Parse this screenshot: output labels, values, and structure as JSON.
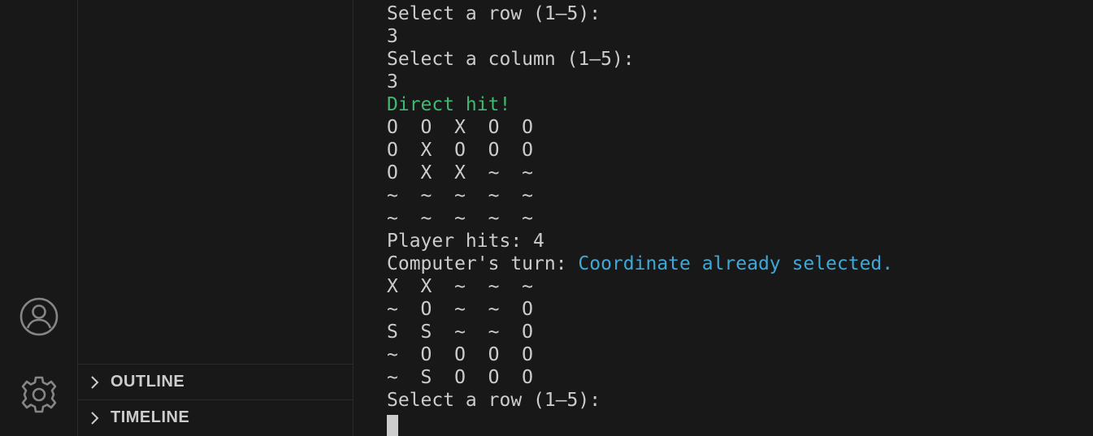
{
  "activity_bar": {
    "account_icon": "account-icon",
    "settings_icon": "gear-icon"
  },
  "sidebar": {
    "sections": [
      {
        "label": "OUTLINE"
      },
      {
        "label": "TIMELINE"
      }
    ]
  },
  "terminal": {
    "lines": [
      {
        "text": "Select a row (1–5):",
        "style": "normal"
      },
      {
        "text": "3",
        "style": "normal"
      },
      {
        "text": "Select a column (1–5):",
        "style": "normal"
      },
      {
        "text": "3",
        "style": "normal"
      },
      {
        "text": "Direct hit!",
        "style": "green"
      },
      {
        "text": "O  O  X  O  O",
        "style": "normal"
      },
      {
        "text": "O  X  O  O  O",
        "style": "normal"
      },
      {
        "text": "O  X  X  ~  ~",
        "style": "normal"
      },
      {
        "text": "~  ~  ~  ~  ~",
        "style": "normal"
      },
      {
        "text": "~  ~  ~  ~  ~",
        "style": "normal"
      },
      {
        "text": "Player hits: 4",
        "style": "normal"
      },
      {
        "text": "Computer's turn: ",
        "style": "normal",
        "suffix": "Coordinate already selected."
      },
      {
        "text": "X  X  ~  ~  ~",
        "style": "normal"
      },
      {
        "text": "~  O  ~  ~  O",
        "style": "normal"
      },
      {
        "text": "S  S  ~  ~  O",
        "style": "normal"
      },
      {
        "text": "~  O  O  O  O",
        "style": "normal"
      },
      {
        "text": "~  S  O  O  O",
        "style": "normal"
      },
      {
        "text": "Select a row (1–5):",
        "style": "normal"
      }
    ]
  },
  "colors": {
    "background": "#181818",
    "text": "#cccccc",
    "success": "#3fb970",
    "info": "#3fa8d6"
  }
}
